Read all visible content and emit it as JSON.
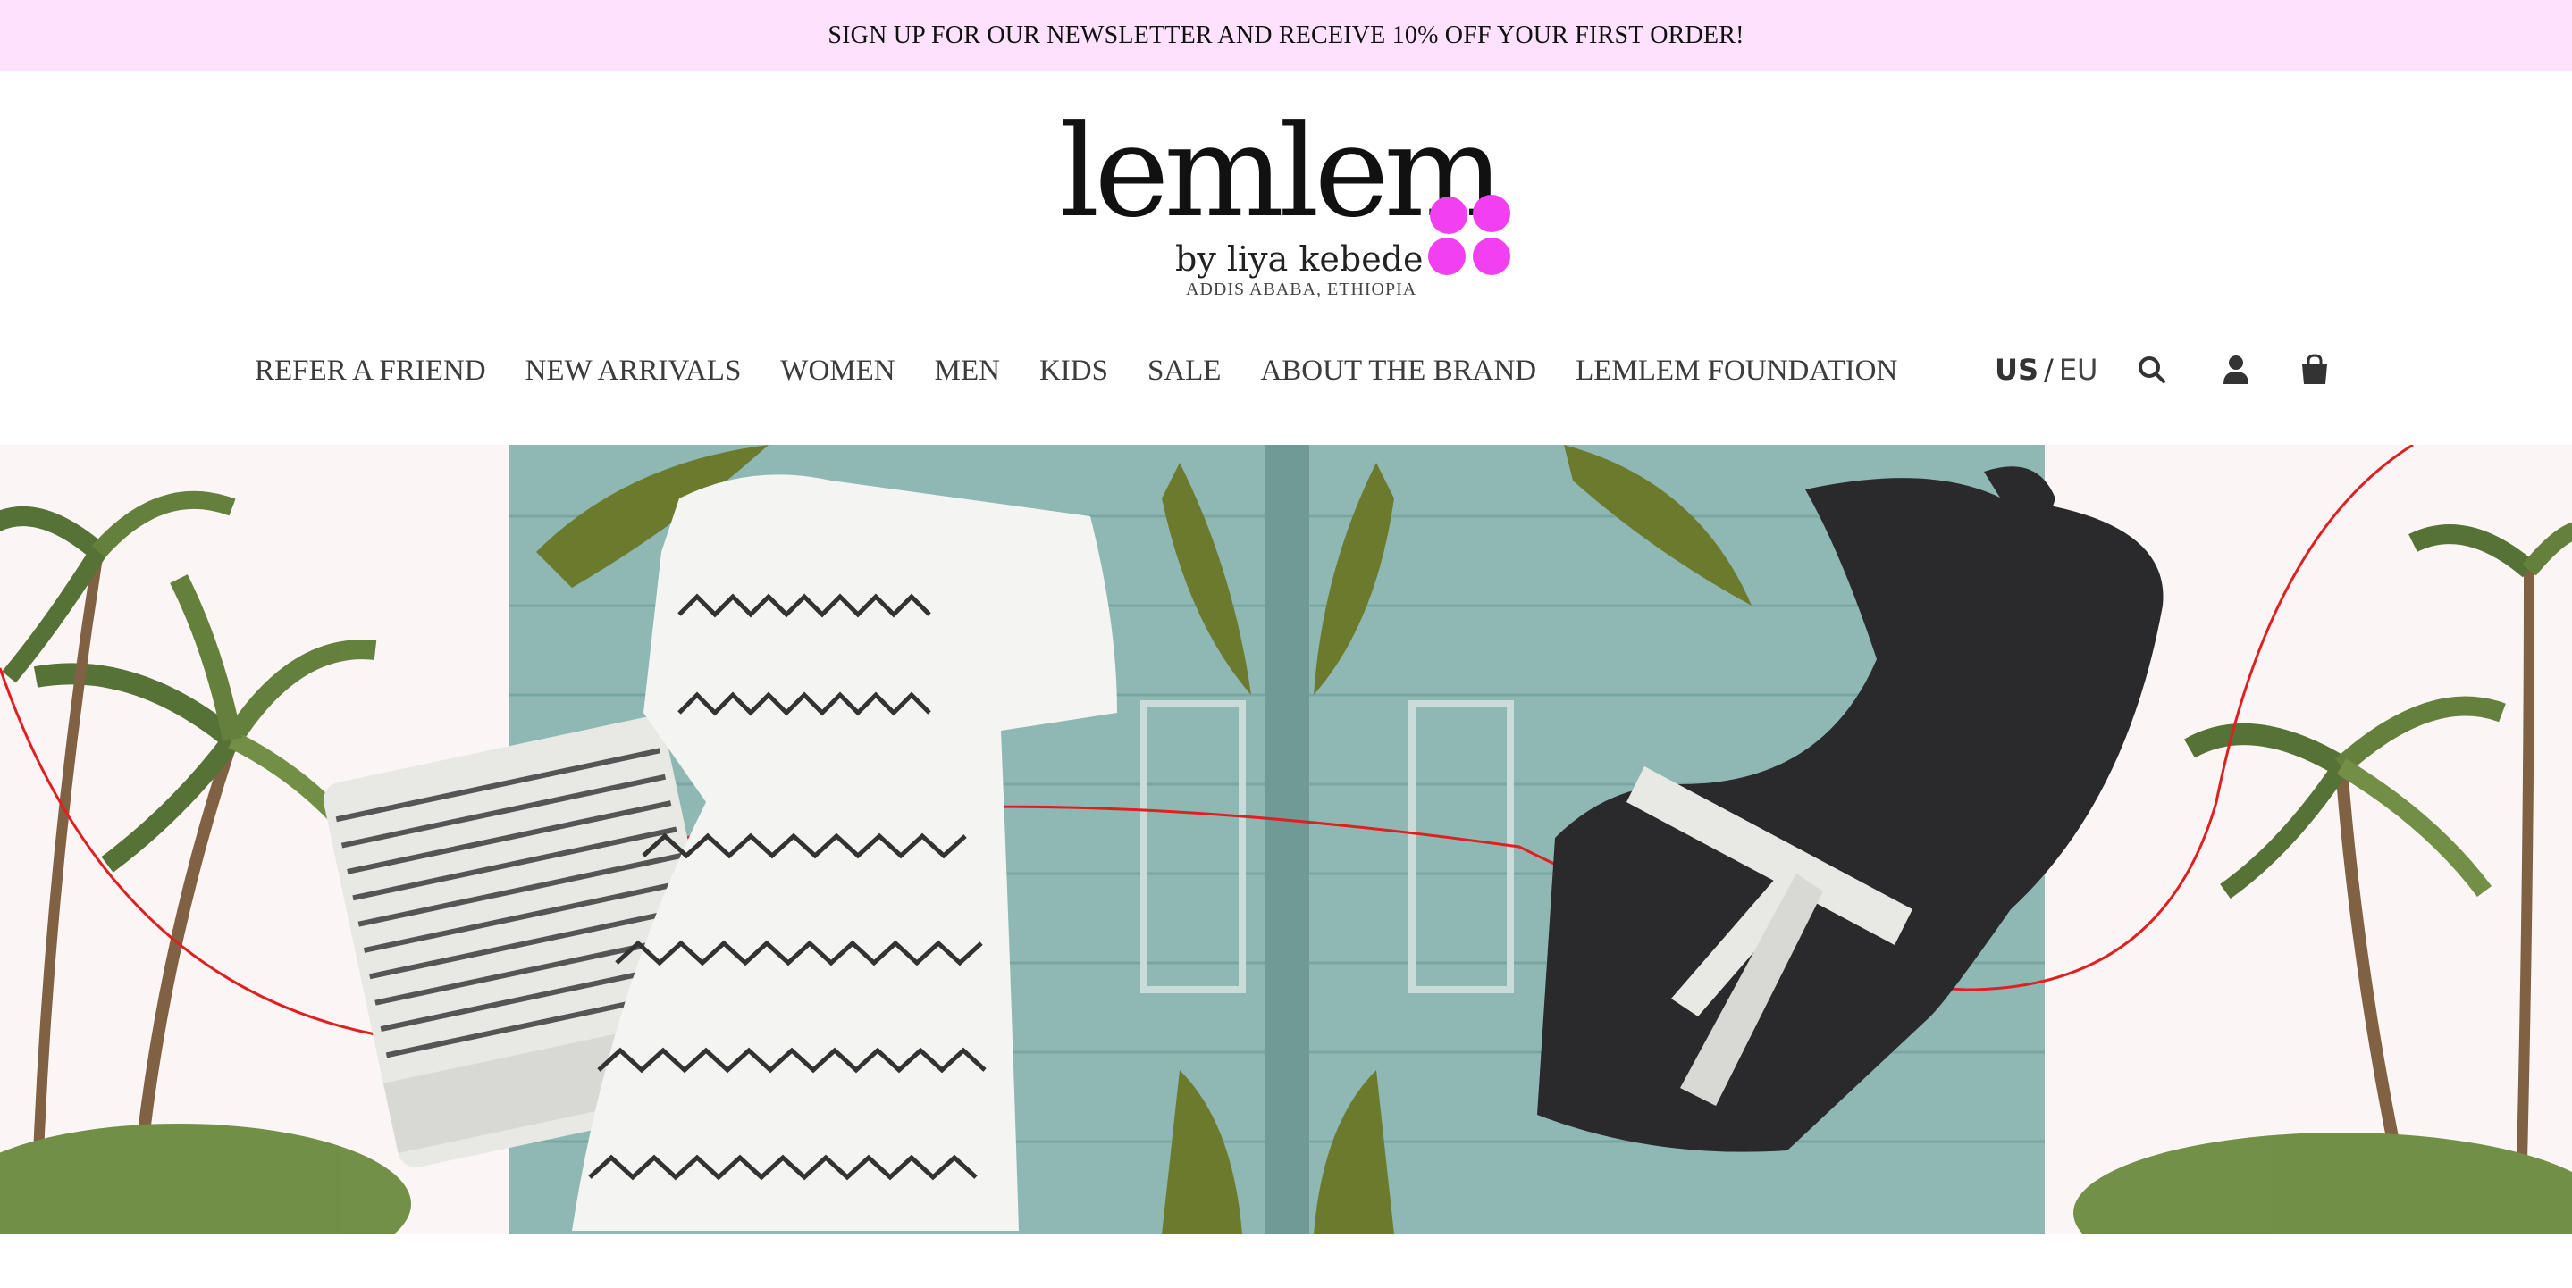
{
  "announcement": {
    "text": "SIGN UP FOR OUR NEWSLETTER AND RECEIVE 10% OFF YOUR FIRST ORDER!"
  },
  "brand": {
    "wordmark": "lemlem",
    "byline": "by liya kebede",
    "location": "ADDIS ABABA, ETHIOPIA",
    "accent_color": "#f23ff0"
  },
  "nav": {
    "items": [
      {
        "label": "REFER A FRIEND"
      },
      {
        "label": "NEW ARRIVALS"
      },
      {
        "label": "WOMEN"
      },
      {
        "label": "MEN"
      },
      {
        "label": "KIDS"
      },
      {
        "label": "SALE"
      },
      {
        "label": "ABOUT THE BRAND"
      },
      {
        "label": "LEMLEM FOUNDATION"
      }
    ]
  },
  "region": {
    "us": "US",
    "separator": "/",
    "eu": "EU",
    "selected": "US"
  },
  "icons": {
    "search": "search-icon",
    "account": "user-icon",
    "cart": "shopping-bag-icon"
  },
  "hero": {
    "alt_description_visible": false,
    "colors": {
      "background": "#fbf6f5",
      "panel": "#8fb8b4",
      "accent_line": "#e02020"
    }
  }
}
